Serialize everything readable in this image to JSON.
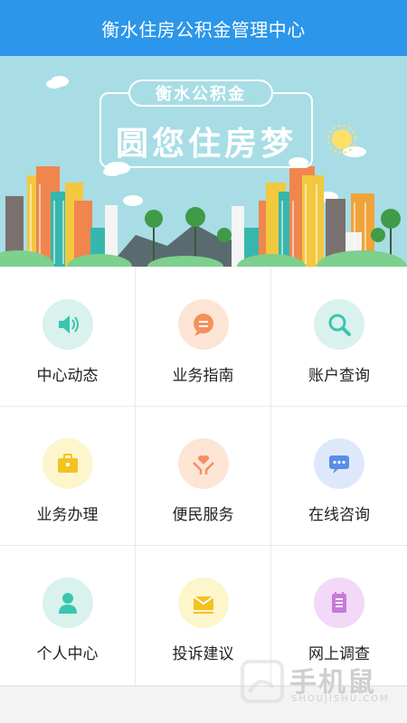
{
  "app": {
    "title": "衡水住房公积金管理中心"
  },
  "banner": {
    "sign_top": "衡水公积金",
    "sign_main": "圆您住房梦"
  },
  "colors": {
    "header": "#2b96ea",
    "banner_sky": "#a8dde6"
  },
  "menu": [
    {
      "label": "中心动态",
      "icon": "speaker-icon",
      "bg": "#d9f2ee",
      "fg": "#3cc5ae"
    },
    {
      "label": "业务指南",
      "icon": "chat-bubble-icon",
      "bg": "#fde5d6",
      "fg": "#f3905f"
    },
    {
      "label": "账户查询",
      "icon": "search-icon",
      "bg": "#d9f2ee",
      "fg": "#3cc5ae"
    },
    {
      "label": "业务办理",
      "icon": "briefcase-icon",
      "bg": "#fdf5cc",
      "fg": "#f2c320"
    },
    {
      "label": "便民服务",
      "icon": "heart-hands-icon",
      "bg": "#fde5d6",
      "fg": "#f3905f"
    },
    {
      "label": "在线咨询",
      "icon": "message-icon",
      "bg": "#dde9fb",
      "fg": "#5a8ee6"
    },
    {
      "label": "个人中心",
      "icon": "person-icon",
      "bg": "#d9f2ee",
      "fg": "#3cc5ae"
    },
    {
      "label": "投诉建议",
      "icon": "envelope-icon",
      "bg": "#fdf5cc",
      "fg": "#f2c320"
    },
    {
      "label": "网上调查",
      "icon": "notepad-icon",
      "bg": "#f1d9f7",
      "fg": "#c67ad8"
    }
  ],
  "watermark": {
    "text": "手机鼠",
    "sub": "SHOUJISHU.COM"
  }
}
